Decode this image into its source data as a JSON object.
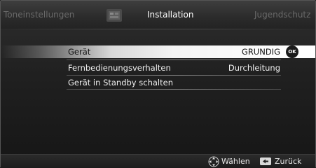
{
  "tabs": {
    "left": "Toneinstellungen",
    "center": "Installation",
    "right": "Jugendschutz",
    "center_icon": "settings-tools-icon"
  },
  "menu": {
    "items": [
      {
        "label": "Gerät",
        "value": "GRUNDIG",
        "selected": true,
        "ok_label": "OK"
      },
      {
        "label": "Fernbedienungsverhalten",
        "value": "Durchleitung",
        "selected": false
      },
      {
        "label": "Gerät in Standby schalten",
        "value": "",
        "selected": false
      }
    ]
  },
  "footer": {
    "choose_label": "Wählen",
    "choose_icon": "navigation-arrows-icon",
    "back_label": "Zurück",
    "back_icon": "back-arrow-icon"
  },
  "colors": {
    "highlight": "#f4f4f4",
    "background": "#202020",
    "text": "#f0f0f0"
  }
}
